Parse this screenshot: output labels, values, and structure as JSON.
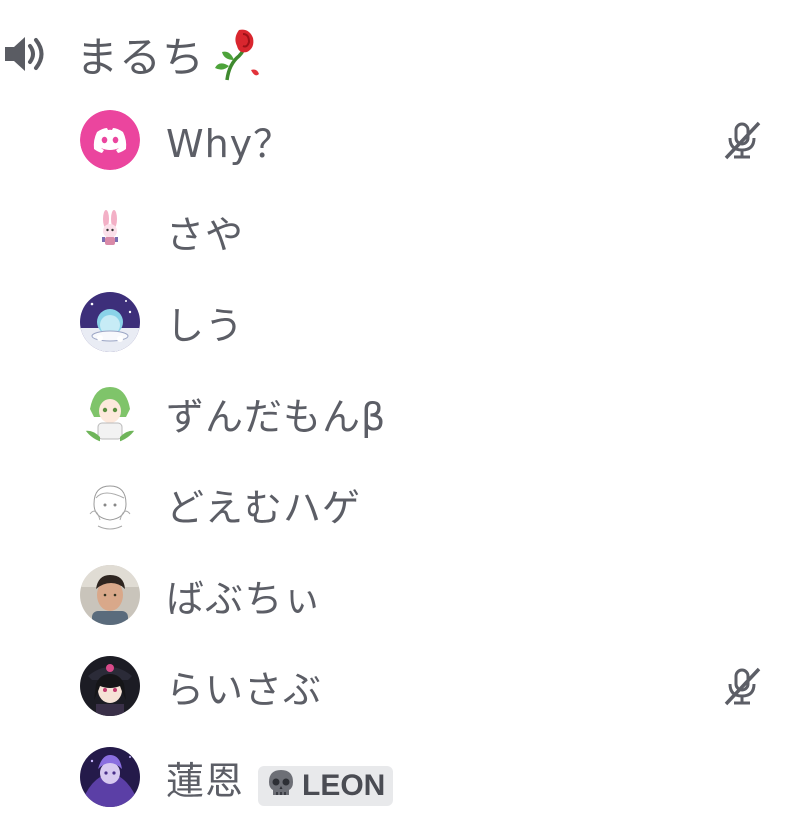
{
  "channel": {
    "name": "まるち",
    "speaker_icon": "speaker-icon",
    "emoji": "wilted-rose-emoji"
  },
  "colors": {
    "text": "#5c5e66",
    "discord_pink": "#eb459e",
    "tag_bg": "#e8e9eb"
  },
  "members": [
    {
      "name": "Why？",
      "avatar": "discord-default-avatar",
      "muted": true
    },
    {
      "name": "さや",
      "avatar": "bunny-avatar",
      "muted": false
    },
    {
      "name": "しう",
      "avatar": "night-cafe-avatar",
      "muted": false
    },
    {
      "name": "ずんだもんβ",
      "avatar": "zundamon-avatar",
      "muted": false
    },
    {
      "name": "どえむハゲ",
      "avatar": "sketch-avatar",
      "muted": false
    },
    {
      "name": "ばぶちぃ",
      "avatar": "photo-avatar",
      "muted": false
    },
    {
      "name": "らいさぶ",
      "avatar": "dark-anime-avatar",
      "muted": true
    },
    {
      "name": "蓮恩",
      "avatar": "purple-anime-avatar",
      "muted": false,
      "tag": {
        "icon": "skull-icon",
        "label": "LEON"
      }
    }
  ]
}
